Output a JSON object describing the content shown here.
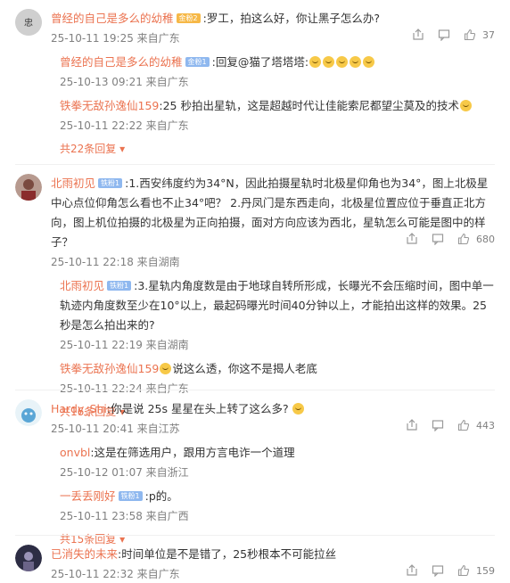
{
  "comments": [
    {
      "user": "曾经的自己是多么的幼稚",
      "medal": "金粉2",
      "text": ":罗工，拍这么好，你让黑子怎么办?",
      "time": "25-10-11 19:25 来自广东",
      "likes": "37",
      "replies": [
        {
          "user": "曾经的自己是多么的幼稚",
          "medal": "金粉1",
          "text": ":回复@猫了塔塔塔:",
          "emojis": 5,
          "time": "25-10-13 09:21 来自广东"
        },
        {
          "user": "铁拳无敌孙逸仙159",
          "medal": "",
          "text": ":25 秒拍出星轨，这是超越时代让佳能索尼都望尘莫及的技术",
          "emojis": 1,
          "time": "25-10-11 22:22 来自广东"
        }
      ],
      "more": "共22条回复"
    },
    {
      "user": "北雨初见",
      "medal": "铁粉1",
      "text": ":1.西安纬度约为34°N，因此拍摄星轨时北极星仰角也为34°，图上北极星中心点位仰角怎么看也不止34°吧？ 2.丹凤门是东西走向，北极星位置应位于垂直正北方向，图上机位拍摄的北极星为正向拍摄，面对方向应该为西北，星轨怎么可能是图中的样子？",
      "time": "25-10-11 22:18 来自湖南",
      "likes": "680",
      "replies": [
        {
          "user": "北雨初见",
          "medal": "铁粉1",
          "text": ":3.星轨内角度数是由于地球自转所形成，长曝光不会压缩时间，图中单一轨迹内角度数至少在10°以上，最起码曝光时间40分钟以上，才能拍出这样的效果。25秒是怎么拍出来的?",
          "emojis": 0,
          "time": "25-10-11 22:19 来自湖南"
        },
        {
          "user": "铁拳无敌孙逸仙159",
          "medal": "",
          "text": "说这么透，你这不是揭人老底",
          "emojis": 1,
          "time": "25-10-11 22:24 来自广东"
        }
      ],
      "more": "共16条回复"
    },
    {
      "user": "Hardy_Shi",
      "medal": "",
      "text": ":你是说 25s 星星在头上转了这么多?",
      "time": "25-10-11 20:41 来自江苏",
      "likes": "443",
      "replies": [
        {
          "user": "onvbl",
          "medal": "",
          "text": ":这是在筛选用户，跟用方言电诈一个道理",
          "emojis": 0,
          "time": "25-10-12 01:07 来自浙江"
        },
        {
          "user": "一丢丢刚好",
          "medal": "铁粉1",
          "text": ":p的。",
          "emojis": 0,
          "time": "25-10-11 23:58 来自广西"
        }
      ],
      "more": "共15条回复"
    },
    {
      "user": "已消失的未来",
      "medal": "",
      "text": ":时间单位是不是错了，25秒根本不可能拉丝",
      "time": "25-10-11 22:32 来自广东",
      "likes": "159",
      "replies": [],
      "more": ""
    }
  ],
  "colors": {
    "username": "#eb7350",
    "meta": "#808080",
    "text": "#333333"
  }
}
